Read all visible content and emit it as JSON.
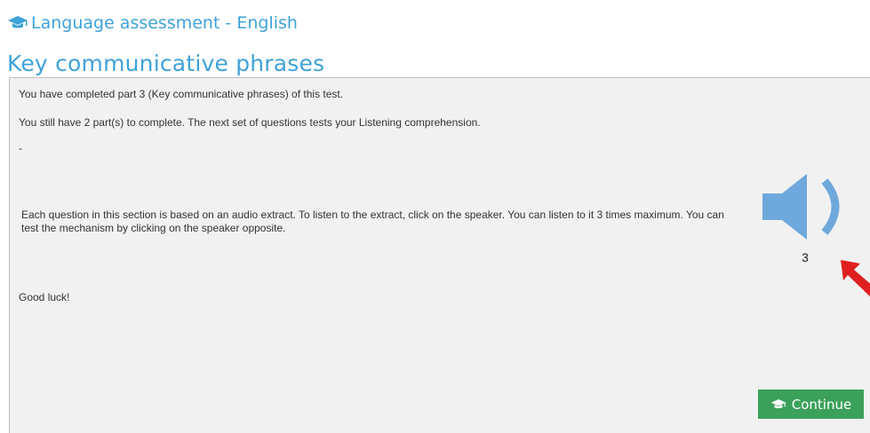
{
  "header": {
    "title": "Language assessment - English",
    "icon": "graduation-cap-icon",
    "color": "#3fa2d8"
  },
  "section": {
    "title": "Key communicative phrases"
  },
  "content": {
    "completed_text": "You have completed part 3 (Key communicative phrases) of this test.",
    "remaining_text": "You still have 2 part(s) to complete. The next set of questions tests your Listening comprehension.",
    "dash": "-",
    "instructions": "Each question in this section is based on an audio extract. To listen to the extract, click on the speaker. You can listen to it 3 times maximum. You can test the mechanism by clicking on the speaker opposite.",
    "good_luck": "Good luck!"
  },
  "audio": {
    "icon": "speaker-icon",
    "plays_remaining": "3",
    "color": "#6fa8dc",
    "pointer_icon": "red-arrow-icon",
    "pointer_color": "#e02020"
  },
  "buttons": {
    "continue_label": "Continue",
    "continue_icon": "graduation-cap-icon",
    "continue_color": "#3aa05a"
  }
}
